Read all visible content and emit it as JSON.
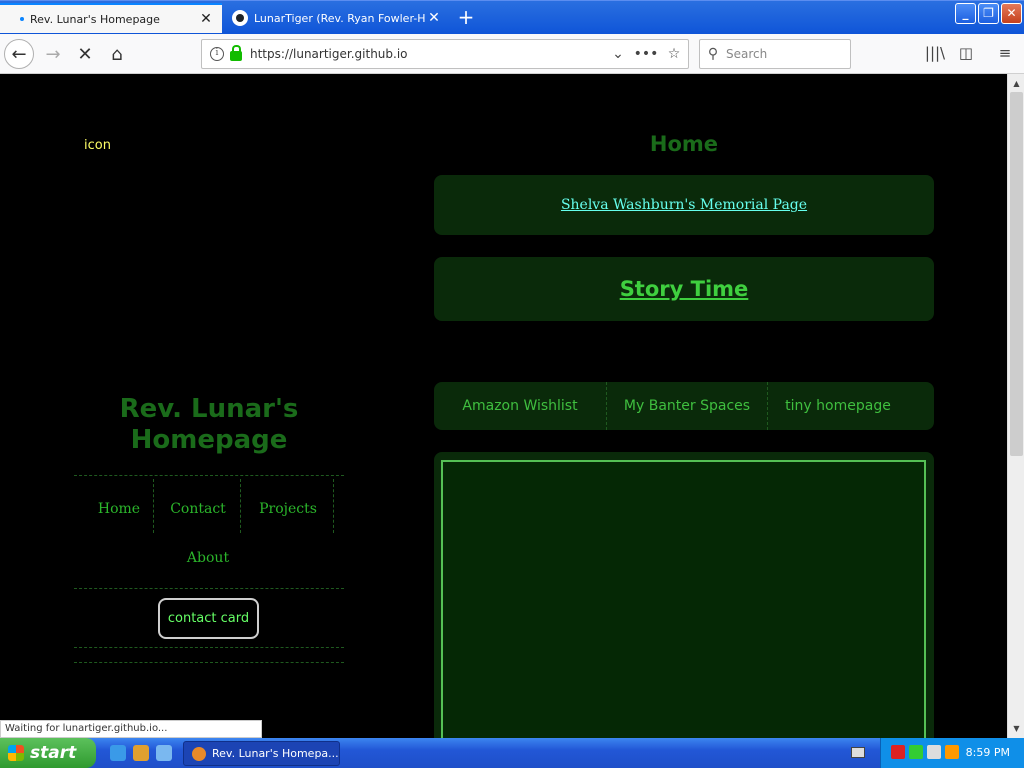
{
  "browser": {
    "tabs": [
      {
        "title": "Rev. Lunar's Homepage",
        "active": true
      },
      {
        "title": "LunarTiger (Rev. Ryan Fowler-Hu",
        "active": false
      }
    ],
    "url": "https://lunartiger.github.io",
    "search_placeholder": "Search",
    "status_text": "Waiting for lunartiger.github.io..."
  },
  "page": {
    "icon_text": "icon",
    "site_title": "Rev. Lunar's Homepage",
    "nav": [
      "Home",
      "Contact",
      "Projects",
      "About"
    ],
    "contact_card": "contact card",
    "home_heading": "Home",
    "memorial_link": "Shelva Washburn's Memorial Page",
    "story_link": "Story Time",
    "links": [
      "Amazon Wishlist",
      "My Banter Spaces",
      "tiny homepage"
    ]
  },
  "taskbar": {
    "start_label": "start",
    "task_label": "Rev. Lunar's Homepa...",
    "clock": "8:59 PM"
  },
  "colors": {
    "title_green": "#1a6b1a",
    "link_green": "#3fcf3f",
    "memorial_cyan": "#66ffee",
    "card_bg": "#0a2a0a"
  }
}
